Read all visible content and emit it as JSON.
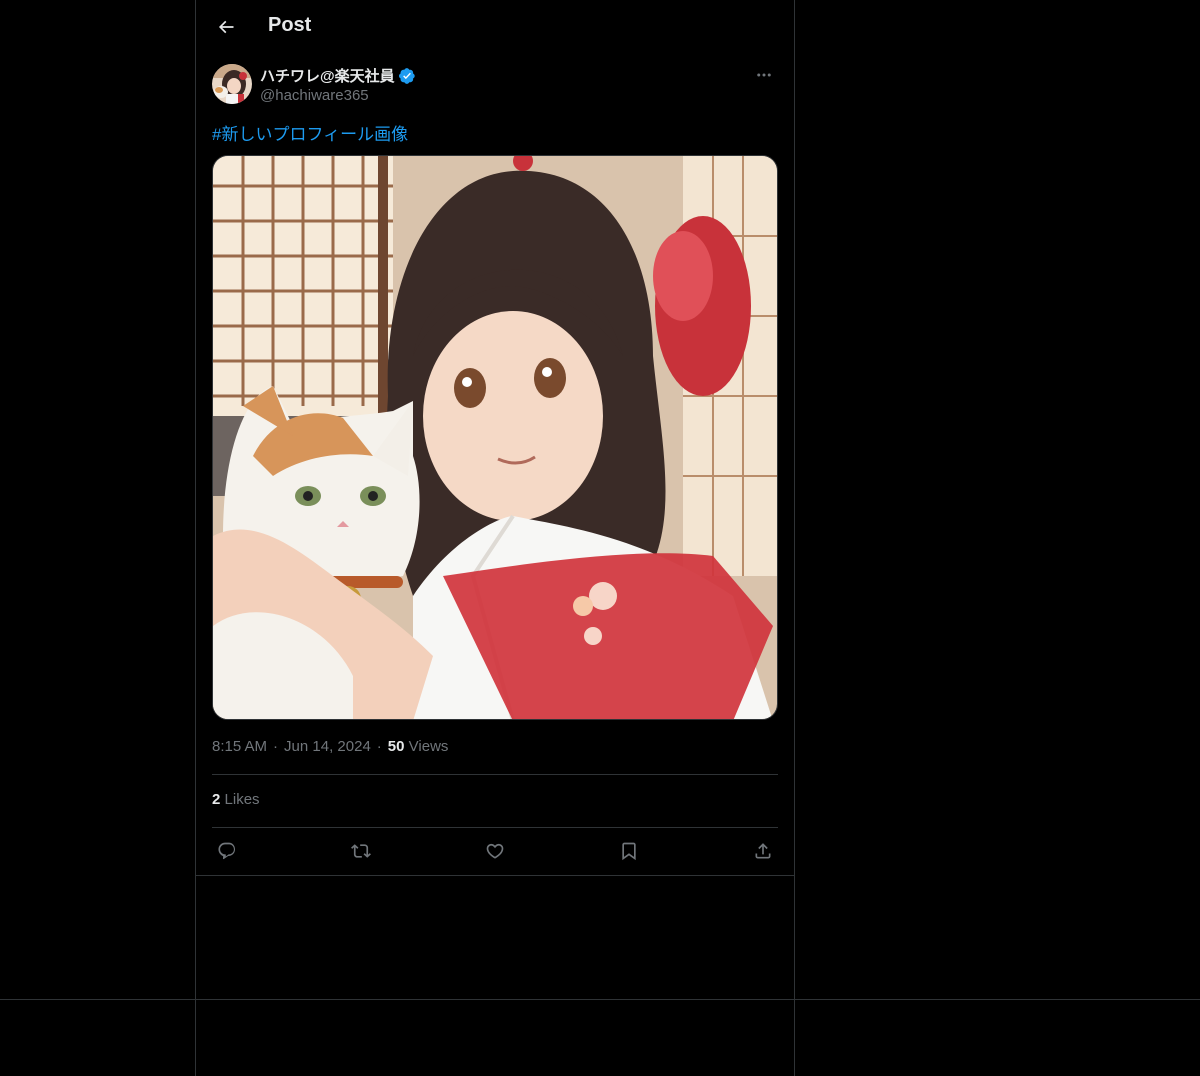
{
  "header": {
    "title": "Post"
  },
  "author": {
    "display_name": "ハチワレ@楽天社員",
    "handle": "@hachiware365",
    "verified": true
  },
  "post": {
    "hashtag": "#新しいプロフィール画像",
    "time": "8:15 AM",
    "separator": "·",
    "date": "Jun 14, 2024",
    "views_count": "50",
    "views_label": "Views",
    "likes_count": "2",
    "likes_label": "Likes"
  },
  "icons": {
    "back": "arrow-left-icon",
    "verified": "verified-badge-icon",
    "more": "more-horizontal-icon",
    "reply": "reply-icon",
    "repost": "repost-icon",
    "like": "heart-icon",
    "bookmark": "bookmark-icon",
    "share": "share-icon"
  },
  "colors": {
    "background": "#000000",
    "text": "#e7e9ea",
    "muted": "#71767b",
    "accent": "#1d9bf0",
    "border": "#2f3336"
  }
}
